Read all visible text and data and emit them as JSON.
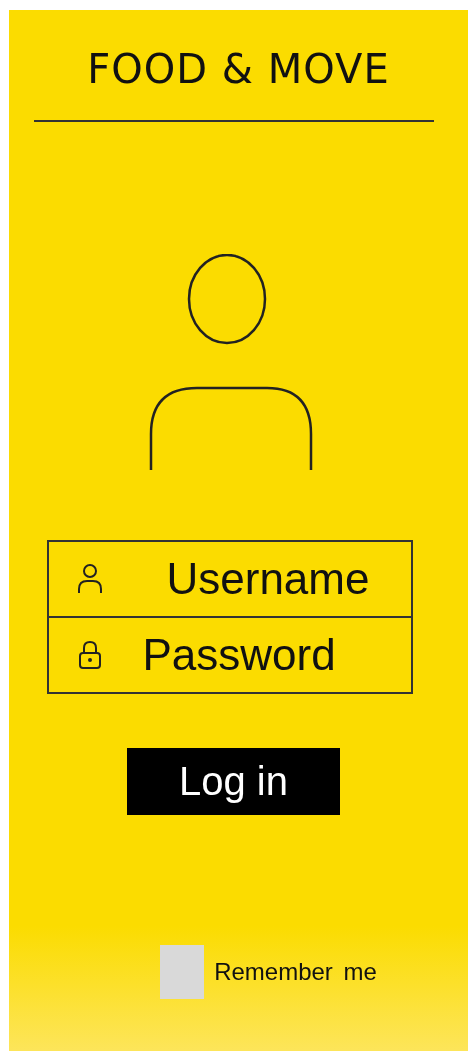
{
  "header": {
    "title": "FOOD & MOVE"
  },
  "form": {
    "fields": [
      {
        "kind": "user",
        "placeholder": "Username"
      },
      {
        "kind": "lock",
        "placeholder": "Password"
      }
    ],
    "login_button": "Log in",
    "remember": {
      "label": "Remember me",
      "checked": false
    }
  }
}
